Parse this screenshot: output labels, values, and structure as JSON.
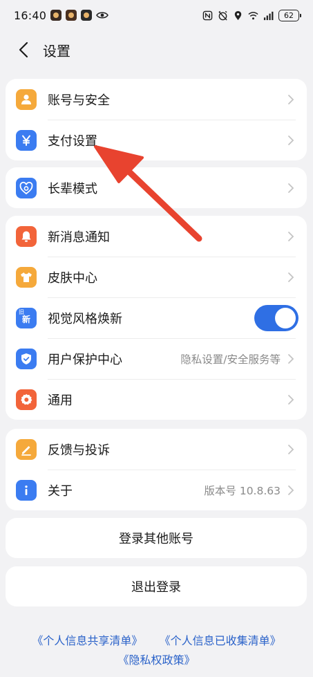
{
  "status_bar": {
    "time": "16:40",
    "battery": "62"
  },
  "header": {
    "title": "设置"
  },
  "groups": [
    {
      "items": [
        {
          "label": "账号与安全",
          "icon": "user-icon",
          "color": "#f5a93b"
        },
        {
          "label": "支付设置",
          "icon": "yen-icon",
          "color": "#3b7cf1"
        }
      ]
    },
    {
      "items": [
        {
          "label": "长辈模式",
          "icon": "elder-heart-icon",
          "color": "#3b7cf1"
        }
      ]
    },
    {
      "items": [
        {
          "label": "新消息通知",
          "icon": "bell-icon",
          "color": "#f2643a"
        },
        {
          "label": "皮肤中心",
          "icon": "shirt-icon",
          "color": "#f5a93b"
        },
        {
          "label": "视觉风格焕新",
          "icon": "old-new-icon",
          "color": "#3b7cf1",
          "icon_text_top": "旧",
          "icon_text_bottom": "新",
          "toggle": "on"
        },
        {
          "label": "用户保护中心",
          "icon": "shield-check-icon",
          "color": "#3b7cf1",
          "value": "隐私设置/安全服务等"
        },
        {
          "label": "通用",
          "icon": "gear-icon",
          "color": "#f2643a"
        }
      ]
    },
    {
      "items": [
        {
          "label": "反馈与投诉",
          "icon": "pen-icon",
          "color": "#f5a93b"
        },
        {
          "label": "关于",
          "icon": "info-icon",
          "color": "#3b7cf1",
          "value": "版本号 10.8.63"
        }
      ]
    }
  ],
  "buttons": {
    "switch_account": "登录其他账号",
    "logout": "退出登录"
  },
  "footer_links": {
    "shared_list": "《个人信息共享清单》",
    "collected_list": "《个人信息已收集清单》",
    "privacy_policy": "《隐私权政策》"
  },
  "colors": {
    "accent_blue": "#2f6fe4",
    "annotation_arrow": "#e8432f",
    "link": "#2a62c9"
  }
}
